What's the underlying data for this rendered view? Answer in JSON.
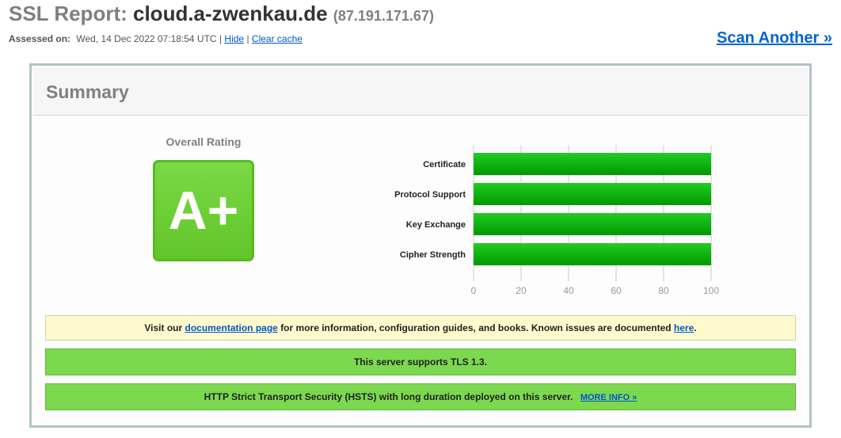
{
  "header": {
    "title_prefix": "SSL Report:",
    "hostname": "cloud.a-zwenkau.de",
    "ip": "(87.191.171.67)",
    "assessed_label": "Assessed on:",
    "assessed_value": "Wed, 14 Dec 2022 07:18:54 UTC",
    "separator": "|",
    "hide_link": "Hide",
    "clear_cache_link": "Clear cache",
    "scan_another": "Scan Another »"
  },
  "summary": {
    "title": "Summary",
    "overall_label": "Overall Rating",
    "grade": "A+",
    "grade_color": "#62c52a"
  },
  "chart_data": {
    "type": "bar",
    "orientation": "horizontal",
    "categories": [
      "Certificate",
      "Protocol Support",
      "Key Exchange",
      "Cipher Strength"
    ],
    "values": [
      100,
      100,
      100,
      100
    ],
    "xticks": [
      "0",
      "20",
      "40",
      "60",
      "80",
      "100"
    ],
    "xlim": [
      0,
      100
    ],
    "grid": true,
    "bar_color": "#11aa11"
  },
  "banners": {
    "doc_prefix": "Visit our",
    "doc_link": "documentation page",
    "doc_middle": "for more information, configuration guides, and books. Known issues are documented",
    "doc_here": "here",
    "doc_end": ".",
    "tls": "This server supports TLS 1.3.",
    "hsts": "HTTP Strict Transport Security (HSTS) with long duration deployed on this server.",
    "hsts_more": "MORE INFO »"
  }
}
